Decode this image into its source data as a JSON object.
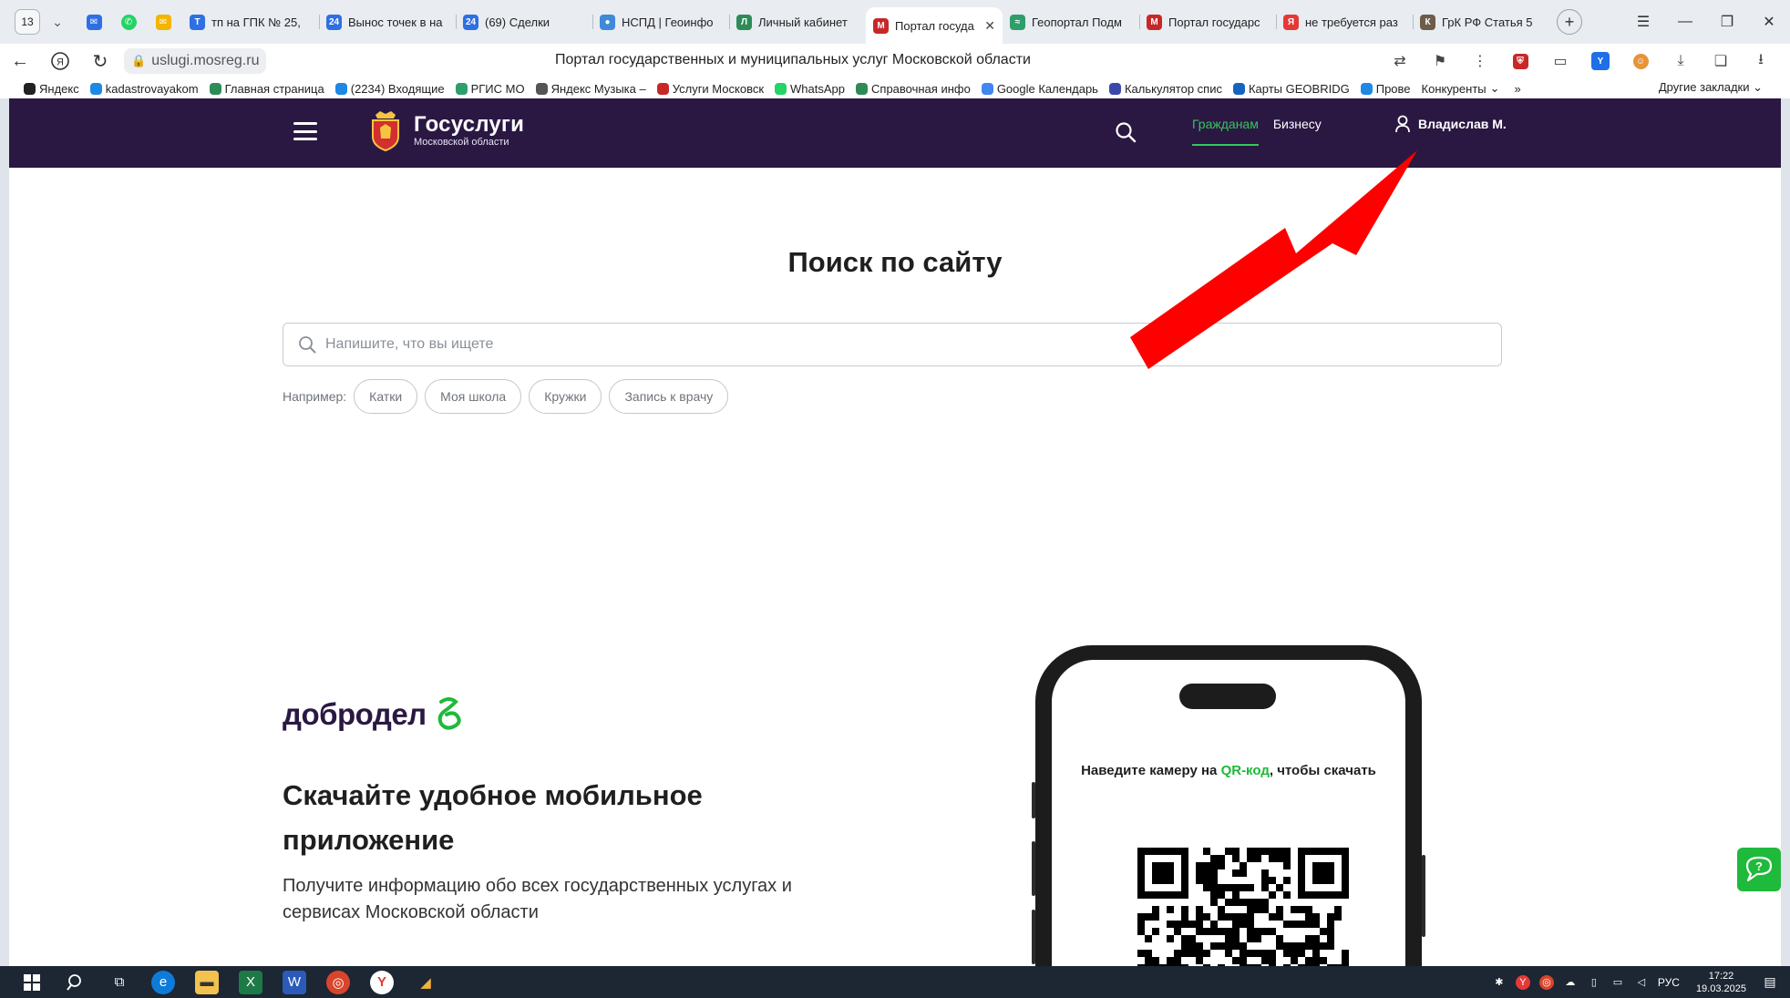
{
  "browser": {
    "tab_count": "13",
    "tabs": [
      {
        "label": "тп на ГПК № 25,",
        "fav": "#2f6fe4",
        "glyph": "Т"
      },
      {
        "label": "Вынос точек в на",
        "fav": "#2f6fe4",
        "glyph": "24"
      },
      {
        "label": "(69) Сделки",
        "fav": "#2f6fe4",
        "glyph": "24"
      },
      {
        "label": "НСПД | Геоинфо",
        "fav": "#3f8ad8",
        "glyph": "●"
      },
      {
        "label": "Личный кабинет",
        "fav": "#2e8b57",
        "glyph": "Л"
      },
      {
        "label": "Портал госуда",
        "fav": "#c62828",
        "glyph": "М",
        "active": true
      },
      {
        "label": "Геопортал Подм",
        "fav": "#2f9e6b",
        "glyph": "≈"
      },
      {
        "label": "Портал государс",
        "fav": "#c62828",
        "glyph": "М"
      },
      {
        "label": "не требуется раз",
        "fav": "#e53935",
        "glyph": "Я"
      },
      {
        "label": "ГрК РФ Статья 5",
        "fav": "#6d5c49",
        "glyph": "К"
      }
    ],
    "url": "uslugi.mosreg.ru",
    "page_title": "Портал государственных и муниципальных услуг Московской области",
    "bookmarks": [
      {
        "label": "Яндекс",
        "fav": "#222222"
      },
      {
        "label": "kadastrovayakom",
        "fav": "#1e88e5"
      },
      {
        "label": "Главная страница",
        "fav": "#2e8b57"
      },
      {
        "label": "(2234) Входящие",
        "fav": "#1e88e5"
      },
      {
        "label": "РГИС МО",
        "fav": "#2f9e6b"
      },
      {
        "label": "Яндекс Музыка –",
        "fav": "#555555"
      },
      {
        "label": "Услуги Московск",
        "fav": "#c62828"
      },
      {
        "label": "WhatsApp",
        "fav": "#25d366"
      },
      {
        "label": "Справочная инфо",
        "fav": "#2e8b57"
      },
      {
        "label": "Google Календарь",
        "fav": "#4285f4"
      },
      {
        "label": "Калькулятор спис",
        "fav": "#3949ab"
      },
      {
        "label": "Карты GEOBRIDG",
        "fav": "#1565c0"
      },
      {
        "label": "Прове",
        "fav": "#1e88e5"
      },
      {
        "label": "Конкуренты",
        "fav": ""
      }
    ],
    "bookmarks_more": "»",
    "other_bookmarks": "Другие закладки"
  },
  "header": {
    "brand": "Госуслуги",
    "brand_sub": "Московской области",
    "nav_citizens": "Гражданам",
    "nav_business": "Бизнесу",
    "user_name": "Владислав М."
  },
  "search": {
    "title": "Поиск по сайту",
    "placeholder": "Напишите, что вы ищете",
    "examples_label": "Например:",
    "examples": [
      "Катки",
      "Моя школа",
      "Кружки",
      "Запись к врачу"
    ]
  },
  "promo": {
    "brand": "добродел",
    "title": "Скачайте удобное мобильное приложение",
    "description": "Получите информацию обо всех государственных услугах и сервисах Московской области",
    "qr_text_before": "Наведите камеру на ",
    "qr_highlight": "QR-код",
    "qr_text_after": ", чтобы скачать"
  },
  "taskbar": {
    "lang": "РУС",
    "time": "17:22",
    "date": "19.03.2025"
  },
  "colors": {
    "header_bg": "#2a1843",
    "accent_green": "#1fb93b",
    "annotation_arrow": "#ff0000"
  }
}
